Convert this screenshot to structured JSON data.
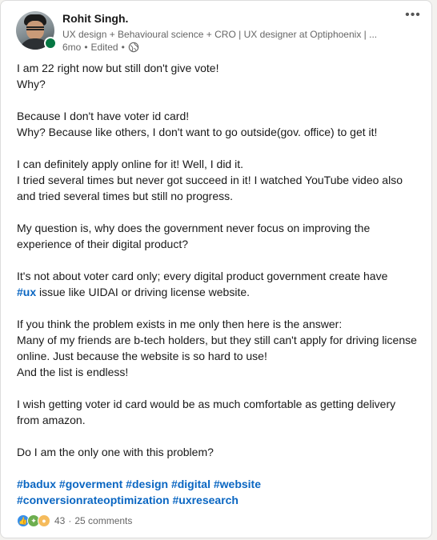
{
  "post": {
    "author": {
      "name": "Rohit Singh.",
      "headline": "UX design + Behavioural science + CRO | UX designer at Optiphoenix | ...",
      "time": "6mo",
      "edited": "Edited",
      "separator": "•"
    },
    "paragraphs": [
      [
        "I am 22 right now but still don't give vote!",
        "Why?"
      ],
      [
        "Because I don't have voter id card!",
        "Why? Because like others, I don't want to go outside(gov. office) to get it!"
      ],
      [
        "I can definitely apply online for it! Well, I did it.",
        "I tried several times but never got succeed in it! I watched YouTube video also and tried several times but still no progress."
      ],
      [
        "My question is, why does the government never focus on improving the experience of their digital product?"
      ],
      [
        "It's not about voter card only; every digital product government create have"
      ],
      [
        "If you think the problem exists in me only then here is the answer:",
        "Many of my friends are b-tech holders, but they still can't apply for driving license online. Just because the website is so hard to use!",
        "And the list is endless!"
      ],
      [
        "I wish getting voter id card would be as much comfortable as getting delivery from amazon."
      ],
      [
        "Do I am the only one with this problem?"
      ]
    ],
    "ux_tag": "#ux",
    "ux_tail": " issue like UIDAI or driving license website.",
    "hashtags": [
      "#badux",
      "#goverment",
      "#design",
      "#digital",
      "#website",
      "#conversionrateoptimization",
      "#uxresearch"
    ],
    "reactions": {
      "count": "43",
      "comments": "25 comments",
      "separator": "·",
      "icons": [
        "like-icon",
        "celebrate-icon",
        "insightful-icon"
      ]
    },
    "menu_icon": "more-options-icon",
    "globe_icon": "globe-icon"
  },
  "colors": {
    "link": "#0a66c2",
    "presence": "#057642",
    "secondary_text": "#666666"
  }
}
